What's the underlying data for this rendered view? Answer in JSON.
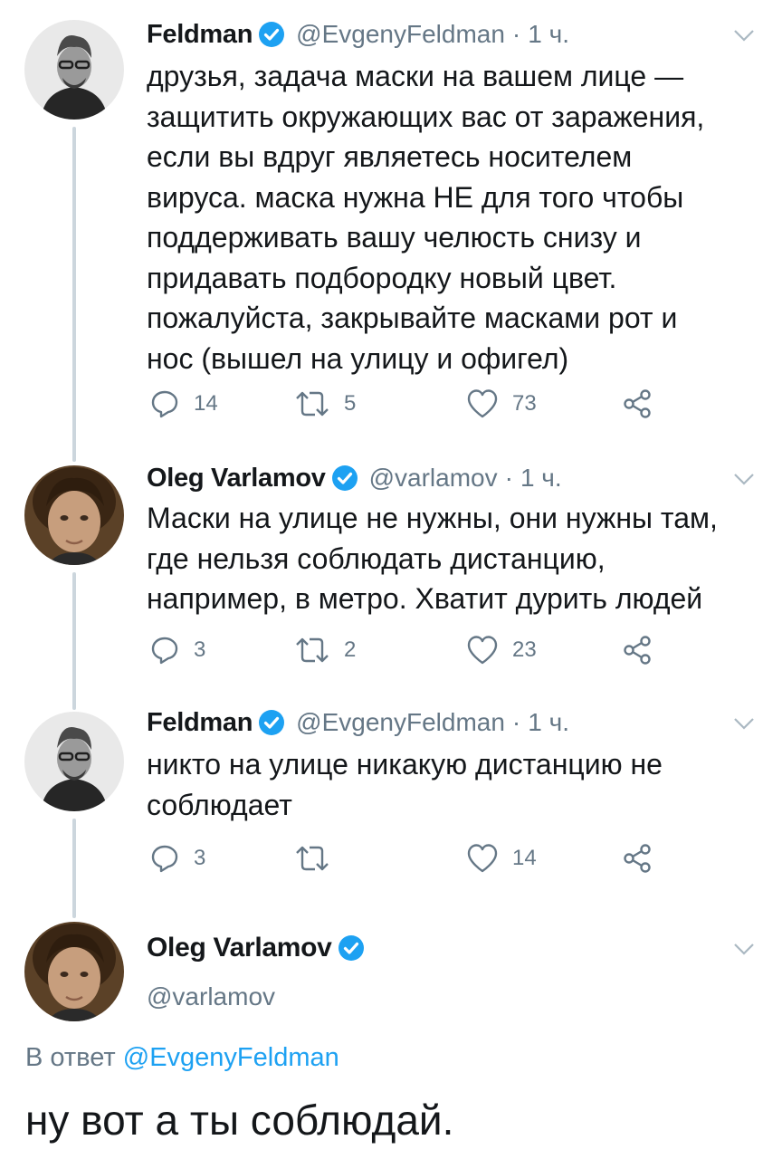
{
  "tweets": [
    {
      "name": "Feldman",
      "handle": "@EvgenyFeldman",
      "dot": "·",
      "time": "1 ч.",
      "text": "друзья, задача маски на вашем лице —\nзащитить окружающих вас от заражения,\nесли вы вдруг являетесь носителем\nвируса. маска нужна НЕ для того чтобы\nподдерживать вашу челюсть снизу и\nпридавать подбородку новый цвет.\nпожалуйста, закрывайте масками рот и\nнос (вышел на улицу и офигел)",
      "replies": "14",
      "retweets": "5",
      "likes": "73"
    },
    {
      "name": "Oleg Varlamov",
      "handle": "@varlamov",
      "dot": "·",
      "time": "1 ч.",
      "text": "Маски на улице не нужны, они нужны там,\nгде нельзя соблюдать дистанцию,\nнапример, в метро. Хватит дурить людей",
      "replies": "3",
      "retweets": "2",
      "likes": "23"
    },
    {
      "name": "Feldman",
      "handle": "@EvgenyFeldman",
      "dot": "·",
      "time": "1 ч.",
      "text": "никто на улице никакую дистанцию не\nсоблюдает",
      "replies": "3",
      "retweets": "",
      "likes": "14"
    }
  ],
  "main_tweet": {
    "name": "Oleg Varlamov",
    "handle": "@varlamov",
    "reply_prefix": "В ответ",
    "reply_to": "@EvgenyFeldman",
    "text": "ну вот а ты соблюдай."
  },
  "icons": {
    "verified": "verified-badge-icon",
    "caret": "chevron-down-icon",
    "reply": "reply-icon",
    "retweet": "retweet-icon",
    "like": "heart-icon",
    "share": "share-icon"
  },
  "colors": {
    "accent": "#1da1f2",
    "secondary_text": "#657786",
    "thread_line": "#ccd6dd"
  }
}
